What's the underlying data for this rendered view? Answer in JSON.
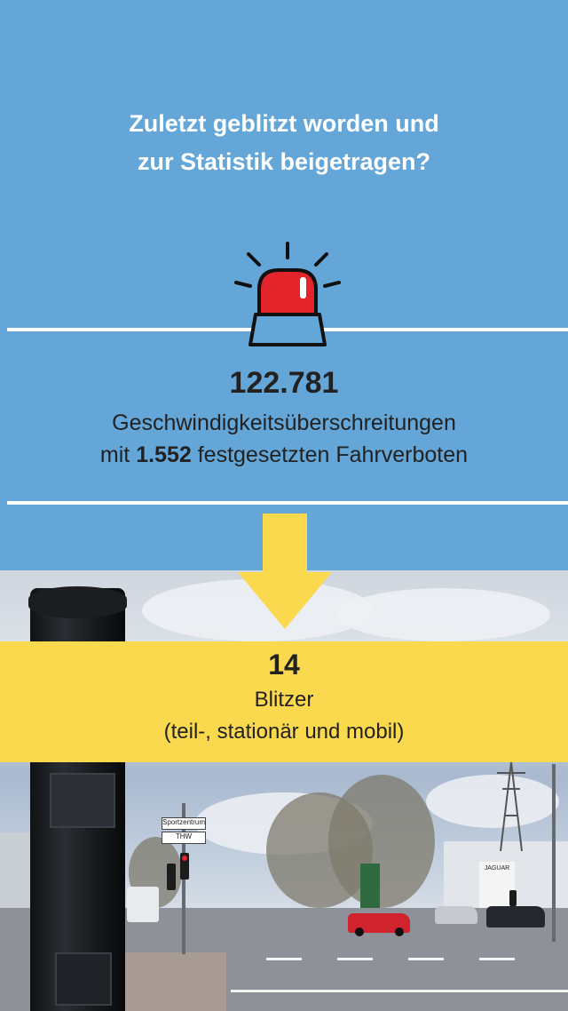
{
  "header": {
    "title_line1": "Zuletzt geblitzt worden und",
    "title_line2": "zur Statistik beigetragen?"
  },
  "stats": {
    "speeding_count": "122.781",
    "speeding_label": "Geschwindigkeitsüberschreitungen",
    "bans_prefix": "mit",
    "bans_count": "1.552",
    "bans_suffix": "festgesetzten Fahrverboten"
  },
  "cameras": {
    "count": "14",
    "label": "Blitzer",
    "types": "(teil-, stationär und mobil)"
  },
  "photo": {
    "sign_top": "Sportzentrum",
    "sign_bottom": "THW",
    "dealer_sign": "JAGUAR"
  },
  "colors": {
    "top_background": "#64a6d8",
    "banner_yellow": "#fbd94e",
    "siren_red": "#e3242b",
    "text_dark": "#222222"
  },
  "icons": [
    "siren-icon",
    "arrow-down-icon"
  ]
}
